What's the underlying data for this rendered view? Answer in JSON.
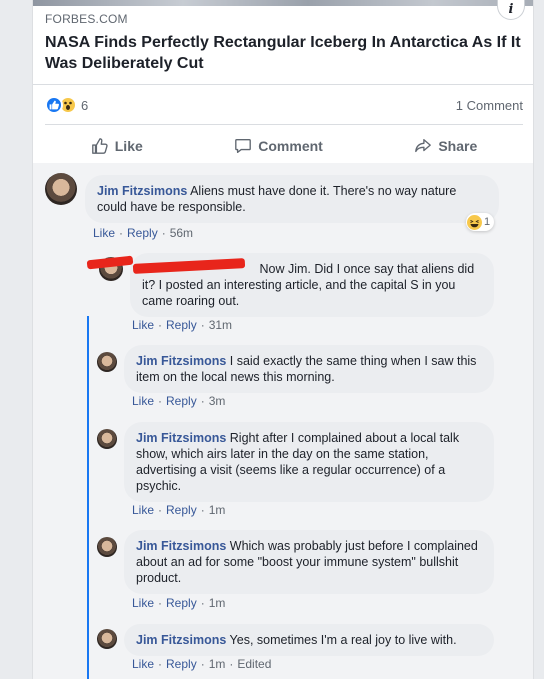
{
  "post": {
    "domain": "FORBES.COM",
    "title": "NASA Finds Perfectly Rectangular Iceberg In Antarctica As If It Was Deliberately Cut",
    "reaction_count": "6",
    "comment_count": "1 Comment",
    "info_icon": "i"
  },
  "actions": {
    "like": "Like",
    "comment": "Comment",
    "share": "Share"
  },
  "comments": [
    {
      "author": "Jim Fitzsimons",
      "text": "Aliens must have done it. There's no way nature could have be responsible.",
      "like": "Like",
      "reply": "Reply",
      "time": "56m",
      "reaction_count": "1"
    },
    {
      "author": "",
      "text": "Now Jim. Did I once say that aliens did it? I posted an interesting article, and the capital S in you came roaring out.",
      "like": "Like",
      "reply": "Reply",
      "time": "31m"
    },
    {
      "author": "Jim Fitzsimons",
      "text": "I said exactly the same thing when I saw this item on the local news this morning.",
      "like": "Like",
      "reply": "Reply",
      "time": "3m"
    },
    {
      "author": "Jim Fitzsimons",
      "text": "Right after I complained about a local talk show, which airs later in the day on the same station, advertising a visit (seems like a regular occurrence) of a psychic.",
      "like": "Like",
      "reply": "Reply",
      "time": "1m"
    },
    {
      "author": "Jim Fitzsimons",
      "text": "Which was probably just before I complained about an ad for some \"boost your immune system\" bullshit product.",
      "like": "Like",
      "reply": "Reply",
      "time": "1m"
    },
    {
      "author": "Jim Fitzsimons",
      "text": "Yes, sometimes I'm a real joy to live with.",
      "like": "Like",
      "reply": "Reply",
      "time": "1m",
      "edited": "Edited"
    }
  ],
  "colors": {
    "link_blue": "#385898",
    "like_blue": "#1877f2",
    "redaction_red": "#e8251b"
  }
}
